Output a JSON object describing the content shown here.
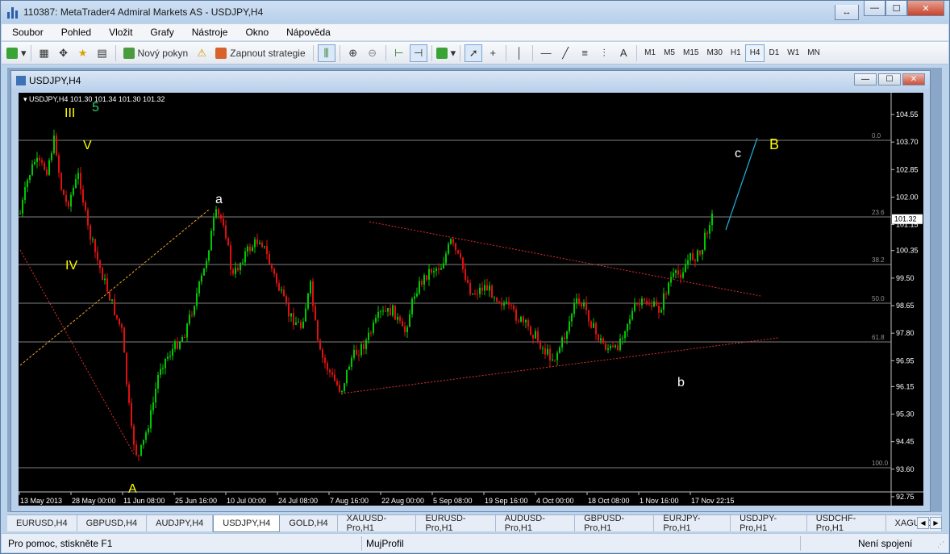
{
  "window": {
    "title": "110387: MetaTrader4 Admiral Markets AS - USDJPY,H4"
  },
  "menu": [
    "Soubor",
    "Pohled",
    "Vložit",
    "Grafy",
    "Nástroje",
    "Okno",
    "Nápověda"
  ],
  "toolbar": {
    "new_order": "Nový pokyn",
    "autotrading": "Zapnout strategie"
  },
  "timeframes": [
    "M1",
    "M5",
    "M15",
    "M30",
    "H1",
    "H4",
    "D1",
    "W1",
    "MN"
  ],
  "active_timeframe": "H4",
  "chart_window": {
    "title": "USDJPY,H4"
  },
  "chart": {
    "info": "USDJPY,H4  101.30 101.34 101.30 101.32",
    "price_labels": [
      "104.55",
      "103.70",
      "102.85",
      "102.00",
      "101.15",
      "100.35",
      "99.50",
      "98.65",
      "97.80",
      "96.95",
      "96.15",
      "95.30",
      "94.45",
      "93.60",
      "92.75"
    ],
    "current_price": "101.32",
    "date_labels": [
      "13 May 2013",
      "28 May 00:00",
      "11 Jun 08:00",
      "25 Jun 16:00",
      "10 Jul 00:00",
      "24 Jul 08:00",
      "7 Aug 16:00",
      "22 Aug 00:00",
      "5 Sep 08:00",
      "19 Sep 16:00",
      "4 Oct 00:00",
      "18 Oct 08:00",
      "1 Nov 16:00",
      "17 Nov 22:15"
    ],
    "fib_levels": [
      "0.0",
      "23.6",
      "38.2",
      "50.0",
      "61.8",
      "100.0"
    ],
    "wave_labels": {
      "III": "III",
      "five": "5",
      "V": "V",
      "IV": "IV",
      "A": "A",
      "a": "a",
      "b": "b",
      "c": "c",
      "B": "B"
    },
    "colors": {
      "bull": "#00c800",
      "bear": "#e01010",
      "background": "#000000",
      "wave_yellow": "#ffff00",
      "wave_white": "#ffffff",
      "projection": "#1eb4dc",
      "fib": "#808080"
    }
  },
  "tabs": [
    "EURUSD,H4",
    "GBPUSD,H4",
    "AUDJPY,H4",
    "USDJPY,H4",
    "GOLD,H4",
    "XAUUSD-Pro,H1",
    "EURUSD-Pro,H1",
    "AUDUSD-Pro,H1",
    "GBPUSD-Pro,H1",
    "EURJPY-Pro,H1",
    "USDJPY-Pro,H1",
    "USDCHF-Pro,H1",
    "XAGUSD"
  ],
  "active_tab": "USDJPY,H4",
  "status": {
    "help": "Pro pomoc, stiskněte F1",
    "profile": "MujProfil",
    "connection": "Není spojení"
  }
}
